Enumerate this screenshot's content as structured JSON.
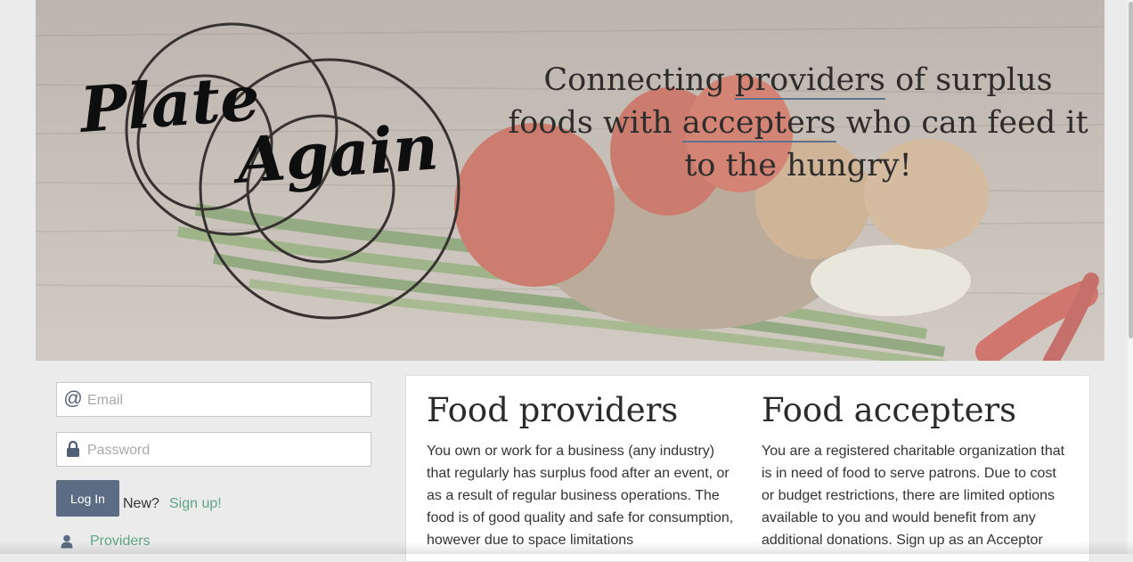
{
  "hero": {
    "logo_line1": "Plate",
    "logo_line2": "Again",
    "tagline": {
      "part1": "Connecting ",
      "word1": "providers",
      "part2": " of surplus foods with ",
      "word2": "accepters",
      "part3": " who can feed it to the hungry!"
    },
    "accent_underline": "#5e7392"
  },
  "login": {
    "email_placeholder": "Email",
    "password_placeholder": "Password",
    "email_icon": "at-sign-icon",
    "password_icon": "lock-icon",
    "login_label": "Log In",
    "new_text": "New?",
    "signup_label": "Sign up!",
    "providers_icon": "user-icon",
    "providers_label": "Providers"
  },
  "panel": {
    "providers": {
      "title": "Food providers",
      "body": "You own or work for a business (any industry) that regularly has surplus food after an event, or as a result of regular business operations. The food is of good quality and safe for consumption, however due to space limitations"
    },
    "accepters": {
      "title": "Food accepters",
      "body": "You are a registered charitable organization that is in need of food to serve patrons. Due to cost or budget restrictions, there are limited options available to you and would benefit from any additional donations. Sign up as an Acceptor"
    }
  },
  "colors": {
    "button": "#5c6c84",
    "link": "#5fa487",
    "page_bg": "#ebebeb"
  }
}
